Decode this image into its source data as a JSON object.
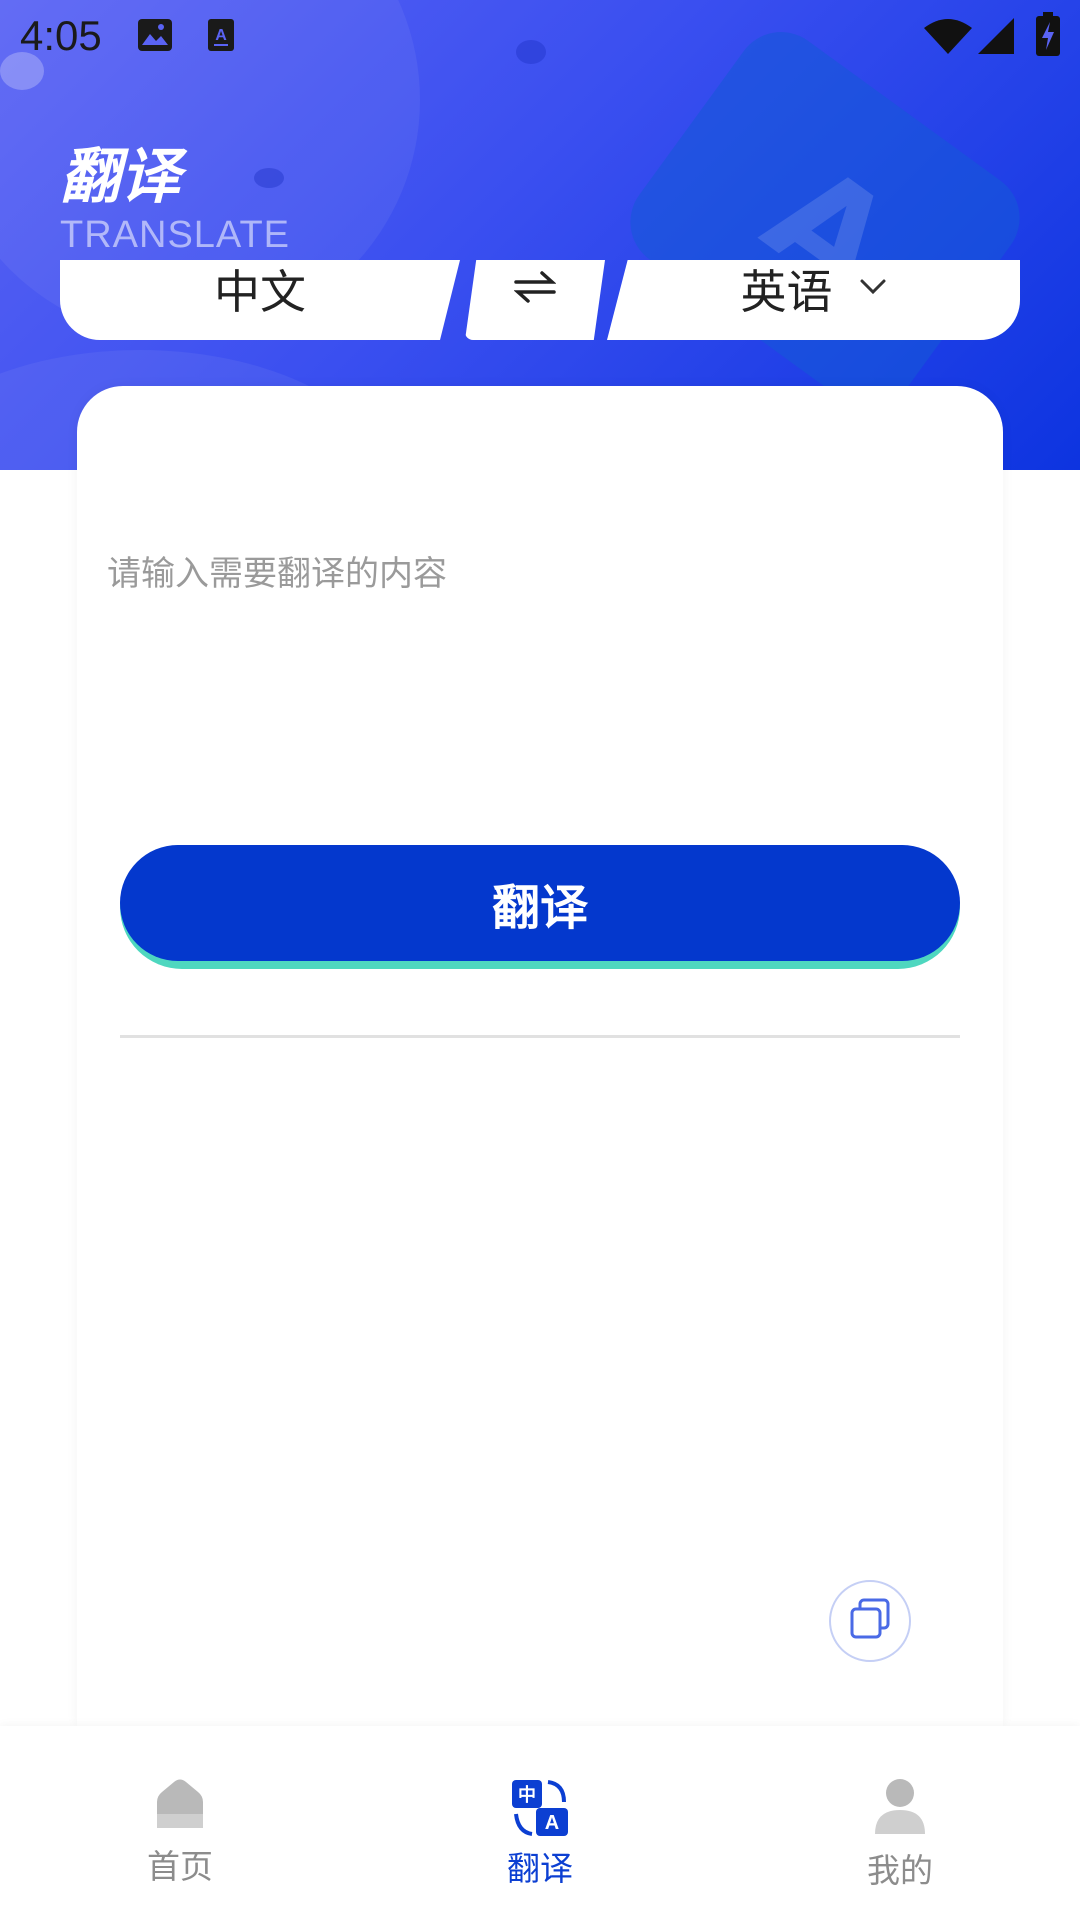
{
  "status_bar": {
    "time": "4:05",
    "icons": [
      "image-icon",
      "translate-a-icon",
      "wifi-icon",
      "signal-icon",
      "battery-icon"
    ]
  },
  "header": {
    "title": "翻译",
    "subtitle": "TRANSLATE"
  },
  "language_bar": {
    "source": "中文",
    "swap_icon": "swap-arrows-icon",
    "target": "英语",
    "target_dropdown_icon": "chevron-down-icon"
  },
  "input": {
    "value": "",
    "placeholder": "请输入需要翻译的内容"
  },
  "translate_button": {
    "label": "翻译"
  },
  "result": {
    "text": "",
    "copy_icon": "copy-icon"
  },
  "bottom_nav": {
    "items": [
      {
        "label": "首页",
        "icon": "home-icon",
        "active": false
      },
      {
        "label": "翻译",
        "icon": "translate-icon",
        "active": true
      },
      {
        "label": "我的",
        "icon": "user-icon",
        "active": false
      }
    ]
  },
  "colors": {
    "header_gradient_start": "#5a63f4",
    "header_gradient_end": "#0d34e0",
    "primary": "#0438cd",
    "button_shadow": "#4ed7bf",
    "nav_active": "#0c3fd2",
    "nav_inactive": "#8c8c8c"
  }
}
